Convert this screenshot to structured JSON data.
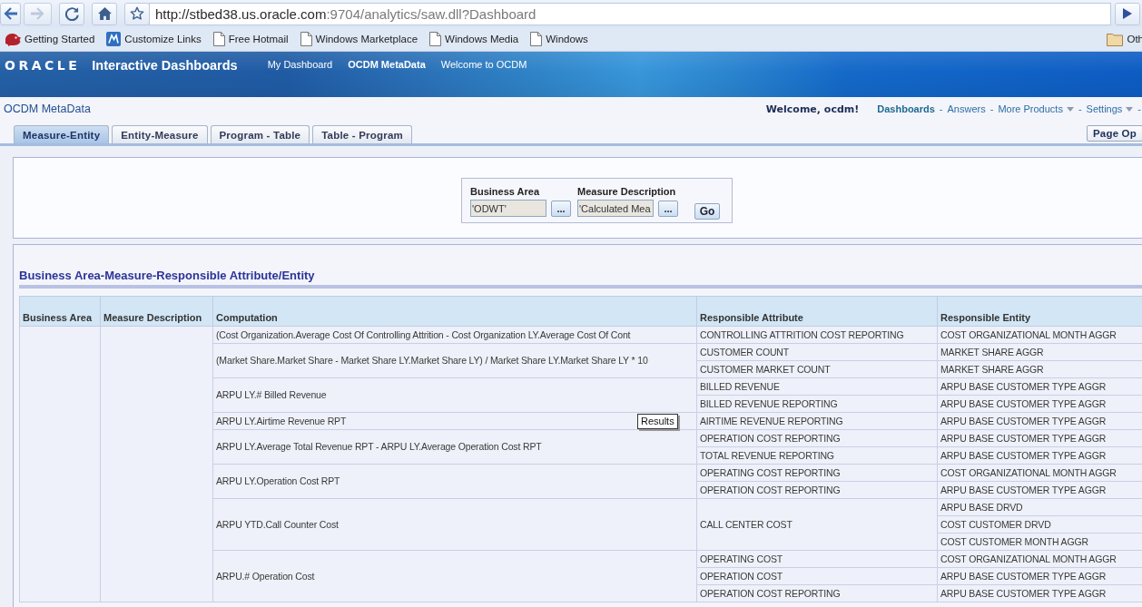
{
  "browser": {
    "back": {
      "disabled": false
    },
    "forward": {
      "disabled": true
    },
    "url_host": "http://stbed38.us.oracle.com",
    "url_path": ":9704/analytics/saw.dll?Dashboard"
  },
  "bookmarks": {
    "items": [
      {
        "label": "Getting Started",
        "kind": "app"
      },
      {
        "label": "Customize Links",
        "kind": "tile"
      },
      {
        "label": "Free Hotmail",
        "kind": "page"
      },
      {
        "label": "Windows Marketplace",
        "kind": "page"
      },
      {
        "label": "Windows Media",
        "kind": "page"
      },
      {
        "label": "Windows",
        "kind": "page"
      }
    ],
    "other": {
      "label": "Oth",
      "kind": "folder"
    }
  },
  "header": {
    "logo": "ORACLE",
    "title": "Interactive Dashboards",
    "nav": [
      {
        "label": "My Dashboard",
        "selected": false
      },
      {
        "label": "OCDM MetaData",
        "selected": true
      },
      {
        "label": "Welcome to OCDM",
        "selected": false
      }
    ]
  },
  "dashboard_bar": {
    "title": "OCDM MetaData",
    "welcome": "Welcome, ocdm!",
    "links": [
      {
        "kind": "link",
        "label": "Dashboards",
        "selected": true,
        "dropdown": false
      },
      {
        "kind": "separator",
        "label": "-"
      },
      {
        "kind": "link",
        "label": "Answers",
        "selected": false,
        "dropdown": false
      },
      {
        "kind": "separator",
        "label": "-"
      },
      {
        "kind": "link",
        "label": "More Products",
        "selected": false,
        "dropdown": true
      },
      {
        "kind": "separator",
        "label": "-"
      },
      {
        "kind": "link",
        "label": "Settings",
        "selected": false,
        "dropdown": true
      },
      {
        "kind": "separator",
        "label": "-"
      }
    ]
  },
  "tabs": [
    {
      "label": "Measure-Entity",
      "selected": true
    },
    {
      "label": "Entity-Measure",
      "selected": false
    },
    {
      "label": "Program - Table",
      "selected": false
    },
    {
      "label": "Table - Program",
      "selected": false
    }
  ],
  "page_options": {
    "label": "Page Op"
  },
  "prompts": {
    "fields": [
      {
        "label": "Business Area",
        "value": "'ODWT'",
        "button": "..."
      },
      {
        "label": "Measure Description",
        "value": "'Calculated Mea",
        "button": "..."
      }
    ],
    "go": "Go"
  },
  "report": {
    "title": "Business Area-Measure-Responsible Attribute/Entity",
    "tooltip": "Results",
    "table": {
      "columns": [
        "Business Area",
        "Measure Description",
        "Computation",
        "Responsible Attribute",
        "Responsible Entity"
      ],
      "groups": [
        {
          "computation": "(Cost Organization.Average Cost Of Controlling Attrition - Cost Organization LY.Average Cost Of Cont",
          "attributes": [
            {
              "attribute": "CONTROLLING ATTRITION COST REPORTING",
              "entities": [
                "COST ORGANIZATIONAL MONTH AGGR"
              ]
            }
          ]
        },
        {
          "computation": "(Market Share.Market Share - Market Share LY.Market Share LY) / Market Share LY.Market Share LY * 10",
          "attributes": [
            {
              "attribute": "CUSTOMER COUNT",
              "entities": [
                "MARKET SHARE AGGR"
              ]
            },
            {
              "attribute": "CUSTOMER MARKET COUNT",
              "entities": [
                "MARKET SHARE AGGR"
              ]
            }
          ]
        },
        {
          "computation": "ARPU LY.# Billed Revenue",
          "attributes": [
            {
              "attribute": "BILLED REVENUE",
              "entities": [
                "ARPU BASE CUSTOMER TYPE AGGR"
              ]
            },
            {
              "attribute": "BILLED REVENUE REPORTING",
              "entities": [
                "ARPU BASE CUSTOMER TYPE AGGR"
              ]
            }
          ]
        },
        {
          "computation": "ARPU LY.Airtime Revenue RPT",
          "attributes": [
            {
              "attribute": "AIRTIME REVENUE REPORTING",
              "entities": [
                "ARPU BASE CUSTOMER TYPE AGGR"
              ]
            }
          ]
        },
        {
          "computation": "ARPU LY.Average Total Revenue RPT - ARPU LY.Average Operation Cost RPT",
          "attributes": [
            {
              "attribute": "OPERATION COST REPORTING",
              "entities": [
                "ARPU BASE CUSTOMER TYPE AGGR"
              ]
            },
            {
              "attribute": "TOTAL REVENUE REPORTING",
              "entities": [
                "ARPU BASE CUSTOMER TYPE AGGR"
              ]
            }
          ]
        },
        {
          "computation": "ARPU LY.Operation Cost RPT",
          "attributes": [
            {
              "attribute": "OPERATING COST REPORTING",
              "entities": [
                "COST ORGANIZATIONAL MONTH AGGR"
              ]
            },
            {
              "attribute": "OPERATION COST REPORTING",
              "entities": [
                "ARPU BASE CUSTOMER TYPE AGGR"
              ]
            }
          ]
        },
        {
          "computation": "ARPU YTD.Call Counter Cost",
          "attributes": [
            {
              "attribute": "CALL CENTER COST",
              "entities": [
                "ARPU BASE DRVD",
                "COST CUSTOMER DRVD",
                "COST CUSTOMER MONTH AGGR"
              ]
            }
          ]
        },
        {
          "computation": "ARPU.# Operation Cost",
          "attributes": [
            {
              "attribute": "OPERATING COST",
              "entities": [
                "COST ORGANIZATIONAL MONTH AGGR"
              ]
            },
            {
              "attribute": "OPERATION COST",
              "entities": [
                "ARPU BASE CUSTOMER TYPE AGGR"
              ]
            },
            {
              "attribute": "OPERATION COST REPORTING",
              "entities": [
                "ARPU BASE CUSTOMER TYPE AGGR"
              ]
            }
          ]
        }
      ]
    }
  }
}
